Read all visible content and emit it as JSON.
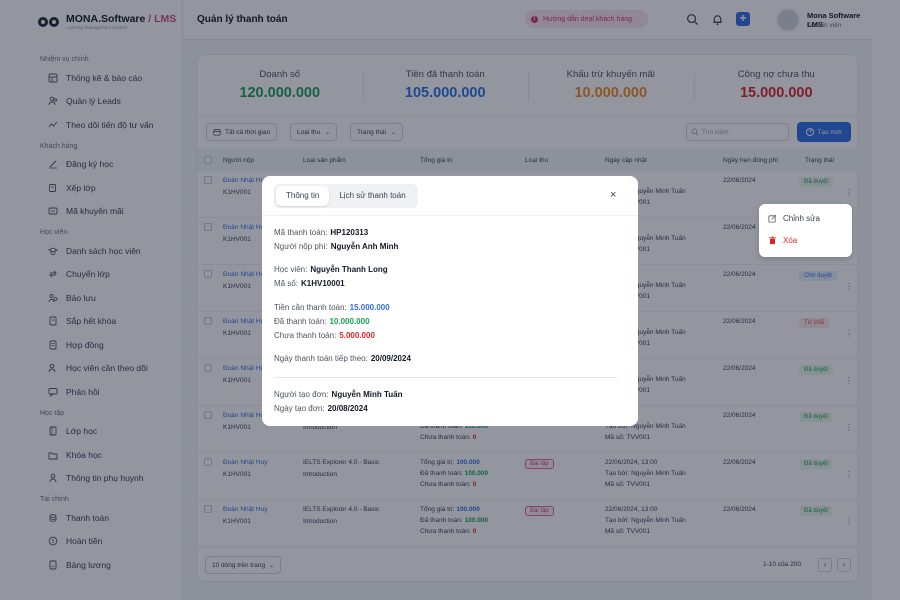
{
  "logo": {
    "brand": "MONA.Software",
    "separator": " / ",
    "product": "LMS",
    "tagline": "Learning Management System"
  },
  "topbar": {
    "title": "Quản lý thanh toán",
    "guide_label": "Hướng dẫn deal khách hàng",
    "user_name": "Mona Software LMS",
    "user_role": "Tư vấn viên"
  },
  "sidebar": {
    "groups": [
      {
        "label": "Nhiệm vụ chính",
        "items": [
          "Thống kê & báo cáo",
          "Quản lý Leads",
          "Theo dõi tiến độ tư vấn"
        ]
      },
      {
        "label": "Khách hàng",
        "items": [
          "Đăng ký học",
          "Xếp lớp",
          "Mã khuyến mãi"
        ]
      },
      {
        "label": "Học viên",
        "items": [
          "Danh sách học viên",
          "Chuyển lớp",
          "Bảo lưu",
          "Sắp hết khóa",
          "Hợp đồng",
          "Học viên cần theo dõi",
          "Phản hồi"
        ]
      },
      {
        "label": "Học tập",
        "items": [
          "Lớp học",
          "Khóa học",
          "Thông tin phụ huynh"
        ]
      },
      {
        "label": "Tài chính",
        "items": [
          "Thanh toán",
          "Hoàn tiền",
          "Bảng lương"
        ]
      }
    ]
  },
  "stats": [
    {
      "label": "Doanh số",
      "value": "120.000.000",
      "color": "#1e9e57"
    },
    {
      "label": "Tiền đã thanh toán",
      "value": "105.000.000",
      "color": "#2f6fe4"
    },
    {
      "label": "Khấu trừ khuyến mãi",
      "value": "10.000.000",
      "color": "#f08a24"
    },
    {
      "label": "Công nợ chưa thu",
      "value": "15.000.000",
      "color": "#dc2626"
    }
  ],
  "filters": {
    "time": "Tất cả thời gian",
    "type": "Loại thu",
    "status": "Trạng thái",
    "search_placeholder": "Tìm kiếm",
    "new_label": "Tạo mới"
  },
  "table": {
    "headers": [
      "Người nộp",
      "Loại sản phẩm",
      "Tổng giá trị",
      "Loại thu",
      "Ngày cập nhật",
      "Ngày hẹn đóng phí",
      "Trạng thái"
    ],
    "labels": {
      "total": "Tổng giá trị:",
      "paid": "Đã thanh toán:",
      "unpaid": "Chưa thanh toán:",
      "created_by": "Tạo bởi:",
      "code": "Mã số:"
    },
    "rows": [
      {
        "payer": "Đoàn Nhật Huy",
        "code": "K1HV001",
        "product": "",
        "product_sub": "",
        "total": "",
        "paid": "",
        "unpaid": "",
        "type": "",
        "updated": "24, 13:00",
        "creator": "Nguyễn Minh Tuấn",
        "staff": "TVV001",
        "due": "22/06/2024",
        "status": "Đã duyệt",
        "status_class": "st-green"
      },
      {
        "payer": "Đoàn Nhật Huy",
        "code": "K1HV001",
        "product": "",
        "product_sub": "",
        "total": "",
        "paid": "",
        "unpaid": "",
        "type": "",
        "updated": "24, 13:00",
        "creator": "Nguyễn Minh Tuấn",
        "staff": "TVV001",
        "due": "22/06/2024",
        "status": "",
        "status_class": ""
      },
      {
        "payer": "Đoàn Nhật Huy",
        "code": "K1HV001",
        "product": "",
        "product_sub": "",
        "total": "",
        "paid": "",
        "unpaid": "",
        "type": "",
        "updated": "24, 13:00",
        "creator": "Nguyễn Minh Tuấn",
        "staff": "TVV001",
        "due": "22/06/2024",
        "status": "Chờ duyệt",
        "status_class": "st-blue"
      },
      {
        "payer": "Đoàn Nhật Huy",
        "code": "K1HV001",
        "product": "",
        "product_sub": "",
        "total": "",
        "paid": "",
        "unpaid": "",
        "type": "",
        "updated": "24, 13:00",
        "creator": "Nguyễn Minh Tuấn",
        "staff": "TVV001",
        "due": "22/06/2024",
        "status": "Từ chối",
        "status_class": "st-red"
      },
      {
        "payer": "Đoàn Nhật Huy",
        "code": "K1HV001",
        "product": "",
        "product_sub": "",
        "total": "",
        "paid": "",
        "unpaid": "",
        "type": "",
        "updated": "24, 13:00",
        "creator": "Nguyễn Minh Tuấn",
        "staff": "TVV001",
        "due": "22/06/2024",
        "status": "Đã duyệt",
        "status_class": "st-green"
      },
      {
        "payer": "Đoàn Nhật Huy",
        "code": "K1HV001",
        "product": "",
        "product_sub": "Introduction",
        "total": "",
        "paid": "100.000",
        "unpaid": "0",
        "type": "",
        "updated": "24, 13:00",
        "creator": "Nguyễn Minh Tuấn",
        "staff": "TVV001",
        "due": "22/06/2024",
        "status": "Đã duyệt",
        "status_class": "st-green"
      },
      {
        "payer": "Đoàn Nhật Huy",
        "code": "K1HV001",
        "product": "IELTS Explorer 4.0 - Basic",
        "product_sub": "Introduction",
        "total": "100.000",
        "paid": "100.000",
        "unpaid": "0",
        "type": "Bài tập",
        "updated": "22/06/2024, 13:00",
        "creator": "Nguyễn Minh Tuấn",
        "staff": "TVV001",
        "due": "22/06/2024",
        "status": "Đã duyệt",
        "status_class": "st-green"
      },
      {
        "payer": "Đoàn Nhật Huy",
        "code": "K1HV001",
        "product": "IELTS Explorer 4.0 - Basic",
        "product_sub": "Introduction",
        "total": "100.000",
        "paid": "100.000",
        "unpaid": "0",
        "type": "Bài tập",
        "updated": "22/06/2024, 13:00",
        "creator": "Nguyễn Minh Tuấn",
        "staff": "TVV001",
        "due": "22/06/2024",
        "status": "Đã duyệt",
        "status_class": "st-green"
      }
    ]
  },
  "pager": {
    "page_size": "10 dòng trên trang",
    "info": "1-10 của 200"
  },
  "context_menu": {
    "edit": "Chỉnh sửa",
    "delete": "Xóa"
  },
  "modal": {
    "tabs": [
      "Thông tin",
      "Lịch sử thanh toán"
    ],
    "payment_code_label": "Mã thanh toán:",
    "payment_code": "HP120313",
    "payer_label": "Người nộp phí:",
    "payer": "Nguyễn Anh Minh",
    "student_label": "Học viên:",
    "student": "Nguyễn Thanh Long",
    "student_code_label": "Mã số:",
    "student_code": "K1HV10001",
    "need_label": "Tiền cần thanh toán:",
    "need": "15.000.000",
    "paid_label": "Đã thanh toán:",
    "paid": "10.000.000",
    "unpaid_label": "Chưa thanh toán:",
    "unpaid": "5.000.000",
    "next_date_label": "Ngày thanh toán tiếp theo:",
    "next_date": "20/09/2024",
    "creator_label": "Người tạo đơn:",
    "creator": "Nguyễn Minh Tuấn",
    "created_label": "Ngày tạo đơn:",
    "created": "20/08/2024"
  },
  "icons": {
    "nav": [
      "chart-icon",
      "users-icon",
      "trend-icon",
      "pen-icon",
      "layers-icon",
      "ticket-icon",
      "graduation-icon",
      "swap-icon",
      "pause-icon",
      "clock-icon",
      "document-icon",
      "user-watch-icon",
      "chat-icon",
      "book-icon",
      "folder-icon",
      "parent-icon",
      "coins-icon",
      "refund-icon",
      "salary-icon"
    ]
  }
}
